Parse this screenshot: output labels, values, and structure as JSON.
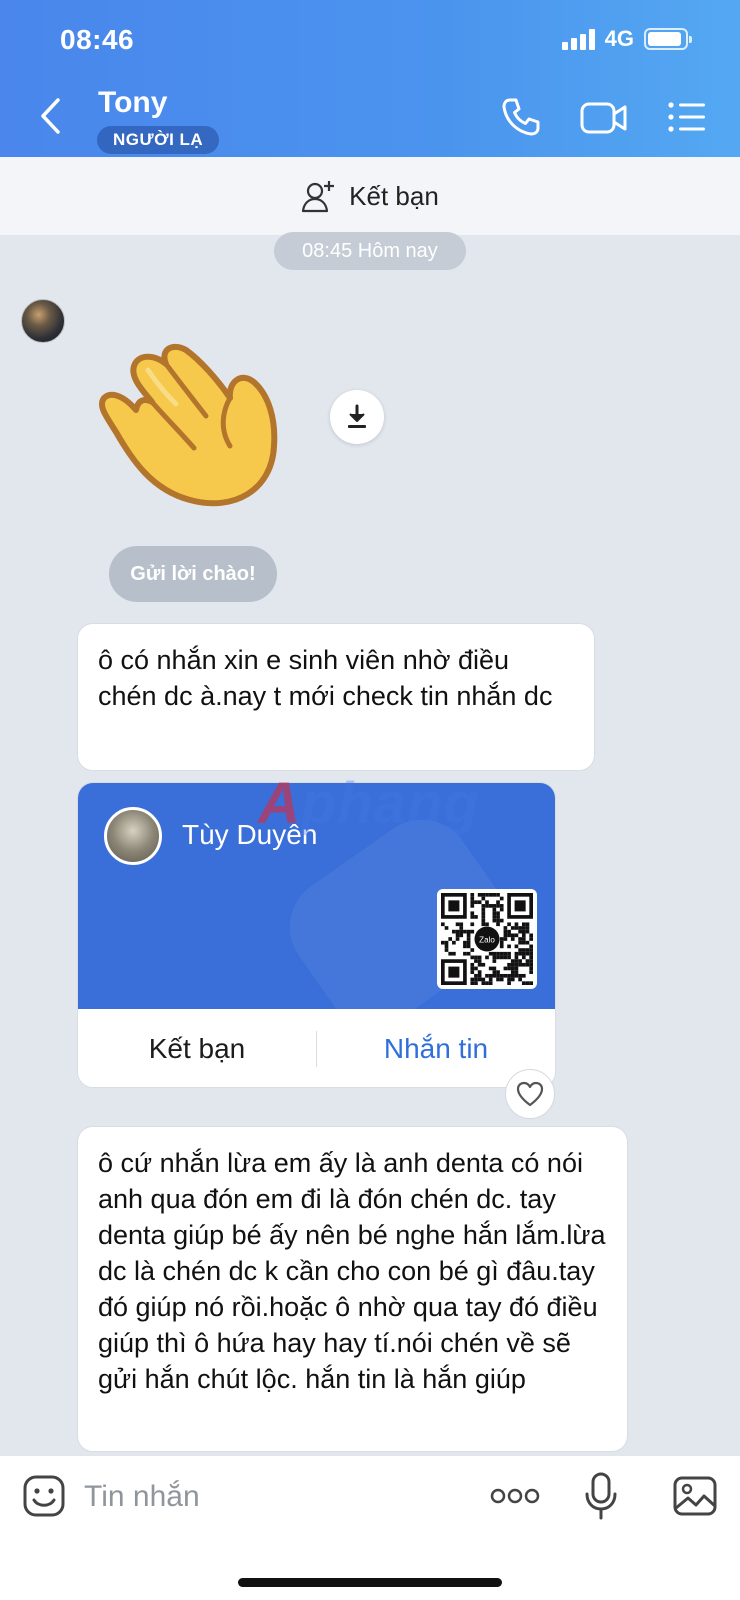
{
  "status_bar": {
    "time": "08:46",
    "network": "4G"
  },
  "header": {
    "contact_name": "Tony",
    "badge": "NGƯỜI LẠ"
  },
  "friend_bar": {
    "label": "Kết bạn"
  },
  "chat": {
    "time_divider": "08:45 Hôm nay",
    "greeting_button": "Gửi lời chào!",
    "message_1": "ô có nhắn xin e sinh viên nhờ điều chén dc à.nay t mới check tin nhắn dc",
    "contact_card": {
      "name": "Tùy Duyên",
      "add_friend": "Kết bạn",
      "send_message": "Nhắn tin",
      "qr_logo": "Zalo"
    },
    "message_2": "ô cứ nhắn lừa em ấy là anh denta có nói anh qua đón em đi là đón chén dc. tay denta giúp bé ấy nên bé nghe hắn lắm.lừa dc là chén dc k cần cho con bé gì đâu.tay đó giúp nó rồi.hoặc ô nhờ qua tay đó điều giúp thì ô hứa hay hay tí.nói chén về sẽ gửi hắn chút lộc. hắn tin là hắn giúp"
  },
  "watermark": {
    "prefix": "A",
    "rest": "phang"
  },
  "input": {
    "placeholder": "Tin nhắn"
  },
  "colors": {
    "header": "#4a8cee",
    "card": "#3a6ed8",
    "link": "#2f6fdb"
  }
}
